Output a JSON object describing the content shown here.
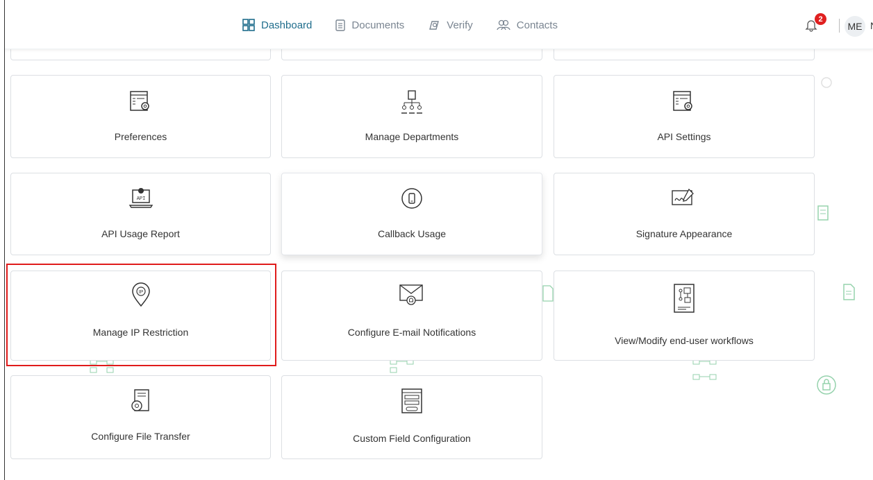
{
  "nav": {
    "items": [
      {
        "label": "Dashboard",
        "icon": "grid-icon",
        "active": true
      },
      {
        "label": "Documents",
        "icon": "document-icon",
        "active": false
      },
      {
        "label": "Verify",
        "icon": "verify-icon",
        "active": false
      },
      {
        "label": "Contacts",
        "icon": "contacts-icon",
        "active": false
      }
    ],
    "notification_count": "2",
    "avatar_initials": "ME",
    "avatar_extra": "N"
  },
  "cards": [
    {
      "label": "Preferences",
      "icon": "settings-window-icon"
    },
    {
      "label": "Manage Departments",
      "icon": "org-chart-icon"
    },
    {
      "label": "API Settings",
      "icon": "settings-window-icon"
    },
    {
      "label": "API Usage Report",
      "icon": "api-laptop-icon"
    },
    {
      "label": "Callback Usage",
      "icon": "phone-callback-icon"
    },
    {
      "label": "Signature Appearance",
      "icon": "signature-icon"
    },
    {
      "label": "Manage IP Restriction",
      "icon": "ip-pin-icon"
    },
    {
      "label": "Configure E-mail Notifications",
      "icon": "email-bell-icon"
    },
    {
      "label": "View/Modify end-user workflows",
      "icon": "workflow-icon"
    },
    {
      "label": "Configure File Transfer",
      "icon": "file-gear-icon"
    },
    {
      "label": "Custom Field Configuration",
      "icon": "form-fields-icon"
    }
  ],
  "colors": {
    "accent": "#1f6d8c",
    "highlight": "#e01b1b",
    "badge": "#e02020",
    "deco": "#3fae6a"
  }
}
